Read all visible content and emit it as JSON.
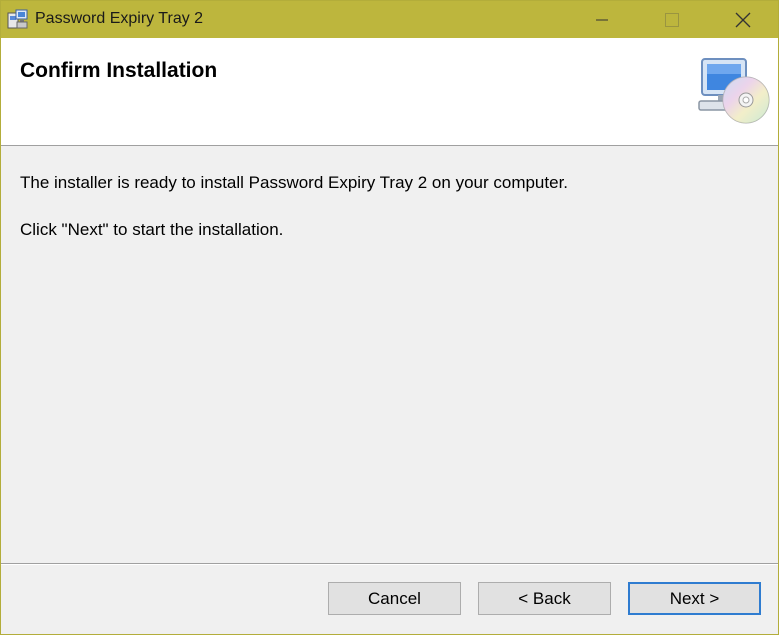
{
  "window": {
    "title": "Password Expiry Tray 2",
    "title_bar_color": "#bdb63d"
  },
  "caption_buttons": {
    "minimize_icon": "minimize-icon",
    "maximize_icon": "maximize-icon",
    "close_icon": "close-icon"
  },
  "header": {
    "title": "Confirm Installation",
    "graphic_icon": "computer-cd-icon"
  },
  "body": {
    "line1": "The installer is ready to install Password Expiry Tray 2 on your computer.",
    "line2": "Click \"Next\" to start the installation."
  },
  "buttons": {
    "cancel": "Cancel",
    "back": "< Back",
    "next": "Next >"
  },
  "colors": {
    "focus_border": "#2f7cd0",
    "dialog_background": "#f0f0f0"
  }
}
